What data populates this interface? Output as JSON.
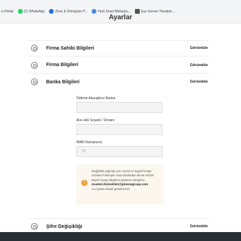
{
  "bookmarks": [
    {
      "label": "e-Portal",
      "color": "#ffffff"
    },
    {
      "label": "(2) WhatsApp",
      "color": "#25d366"
    },
    {
      "label": "Zirve E-Dönüşüm P...",
      "color": "#2a6fdb"
    },
    {
      "label": "Hızlı Sosd Mektubu...",
      "color": "#4a8ad9"
    },
    {
      "label": "Eşs Gereer Hesabin...",
      "color": "#555555"
    }
  ],
  "page_title": "Ayarlar",
  "sections": [
    {
      "title": "Firma Sahibi Bilgileri",
      "action": "Görüntüle"
    },
    {
      "title": "Firma Bilgileri",
      "action": "Görüntüle"
    },
    {
      "title": "Banka Bilgileri",
      "action": "Görüntüle"
    }
  ],
  "bank_form": {
    "bank_label": "Ödeme Alacağınız Banka",
    "bank_value": "",
    "name_label": "Alıcı Adı Soyadı / Ünvanı",
    "name_value": "",
    "iban_label": "IBAN Numaranız",
    "iban_placeholder": "TR"
  },
  "info": {
    "text": "Değişiklik yapmak için: İmzalı ve kaşeli hesap cüzdanı fotokopisi veya bankadan alınan imzalı kaşeli hesap bilgilerini gösteren belgeleri",
    "email": "musteri.hizmetleri@pluseegroup.com",
    "suffix": "'a e-posta olarak göndeririniz.",
    "accent": "#f0a030"
  },
  "bottom_section": {
    "title": "Şifre Değişikliği",
    "action": "Görüntüle"
  }
}
